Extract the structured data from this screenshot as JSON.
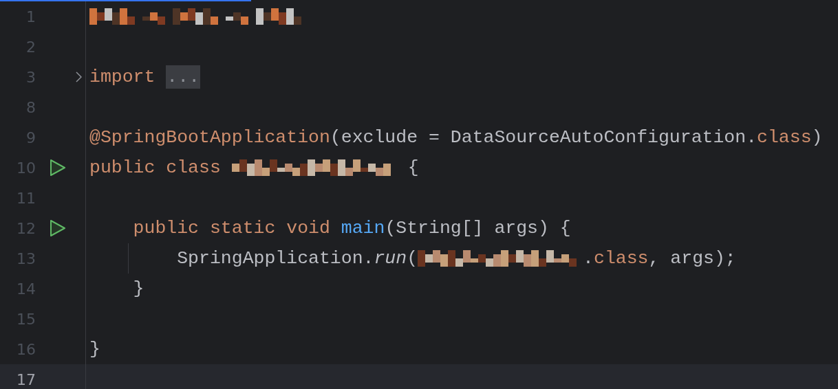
{
  "loading_bar": {
    "level": 0.3
  },
  "lines": [
    {
      "number": "1",
      "tokens": [
        {
          "kind": "redacted-line"
        }
      ]
    },
    {
      "number": "2"
    },
    {
      "number": "3",
      "fold": true,
      "tokens": [
        {
          "kind": "keyword",
          "text": "import "
        },
        {
          "kind": "folded",
          "text": "..."
        }
      ]
    },
    {
      "number": "8"
    },
    {
      "number": "9",
      "tokens": [
        {
          "kind": "annotation",
          "text": "@SpringBootApplication"
        },
        {
          "kind": "plain",
          "text": "(exclude = DataSourceAutoConfiguration."
        },
        {
          "kind": "keyword",
          "text": "class"
        },
        {
          "kind": "plain",
          "text": ")"
        }
      ]
    },
    {
      "number": "10",
      "run_icon": true,
      "tokens": [
        {
          "kind": "keyword",
          "text": "public class "
        },
        {
          "kind": "redacted-name"
        },
        {
          "kind": "plain",
          "text": " {"
        }
      ]
    },
    {
      "number": "11"
    },
    {
      "number": "12",
      "run_icon": true,
      "tokens": [
        {
          "kind": "keyword",
          "text": "    public static void "
        },
        {
          "kind": "method",
          "text": "main"
        },
        {
          "kind": "plain",
          "text": "(String[] args) {"
        }
      ]
    },
    {
      "number": "13",
      "indent_guide": true,
      "tokens": [
        {
          "kind": "plain",
          "text": "        SpringApplication."
        },
        {
          "kind": "static-call",
          "text": "run"
        },
        {
          "kind": "plain",
          "text": "("
        },
        {
          "kind": "redacted-name"
        },
        {
          "kind": "plain",
          "text": "."
        },
        {
          "kind": "keyword",
          "text": "class"
        },
        {
          "kind": "plain",
          "text": ", args);"
        }
      ]
    },
    {
      "number": "14",
      "tokens": [
        {
          "kind": "plain",
          "text": "    }"
        }
      ]
    },
    {
      "number": "15"
    },
    {
      "number": "16",
      "tokens": [
        {
          "kind": "plain",
          "text": "}"
        }
      ]
    },
    {
      "number": "17",
      "current": true
    }
  ]
}
